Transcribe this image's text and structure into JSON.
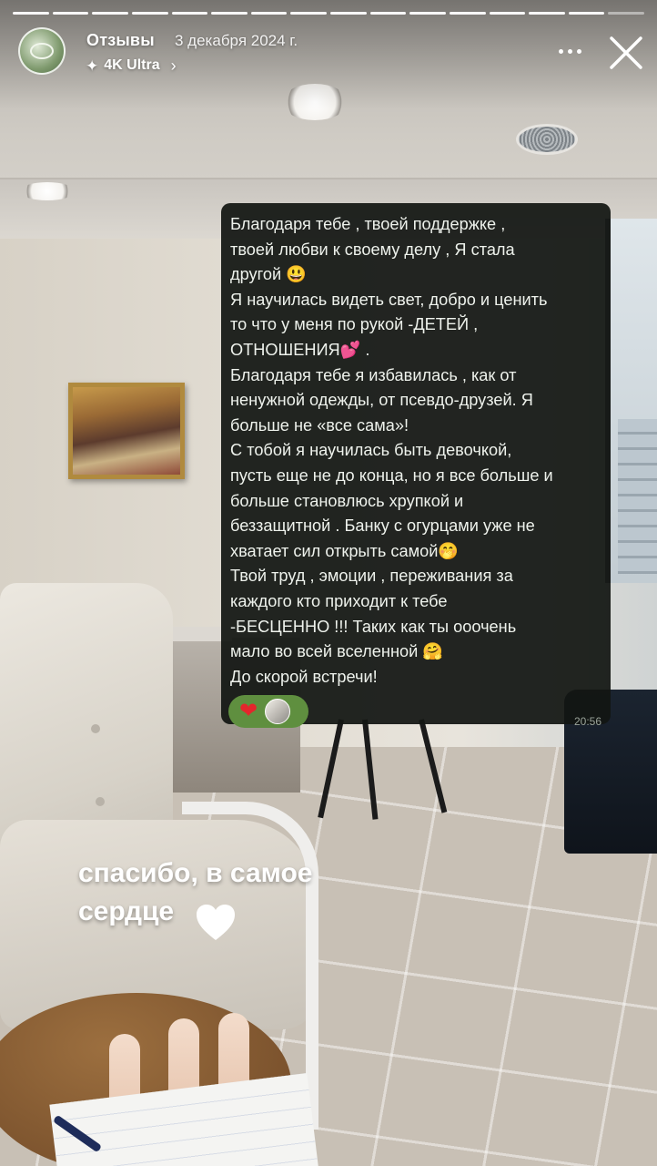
{
  "story": {
    "progress_segments": 16,
    "segments_seen": 15,
    "account_name": "Отзывы",
    "date": "3 декабря 2024 г.",
    "quality_badge": "4K Ultra",
    "icons": {
      "quality": "sparkle-icon",
      "quality_chevron": "chevron-right-icon",
      "more": "more-dots-icon",
      "close": "close-icon"
    }
  },
  "message": {
    "text": "Благодаря тебе , твоей поддержке ,\nтвоей любви к своему делу , Я стала\nдругой 😃\nЯ научилась видеть свет, добро и ценить\nто что у меня по рукой -ДЕТЕЙ ,\nОТНОШЕНИЯ💕 .\nБлагодаря тебе я избавилась , как от\nненужной одежды, от псевдо-друзей. Я\nбольше не «все сама»!\nС тобой я научилась быть девочкой,\nпусть еще не до конца, но я все больше и\nбольше становлюсь хрупкой и\nбеззащитной . Банку с огурцами уже не\nхватает сил открыть самой🤭\nТвой труд , эмоции , переживания за\nкаждого кто приходит к тебе\n-БЕСЦЕННО !!! Таких как ты ооочень\nмало во всей вселенной 🤗\nДо скорой встречи!",
    "reaction_emoji": "❤",
    "time": "20:56"
  },
  "caption": {
    "line1": "спасибо, в самое",
    "line2": "сердце"
  },
  "colors": {
    "message_bg": "#121612",
    "reaction_bg": "#5f8f3f",
    "accent_white": "#ffffff"
  }
}
